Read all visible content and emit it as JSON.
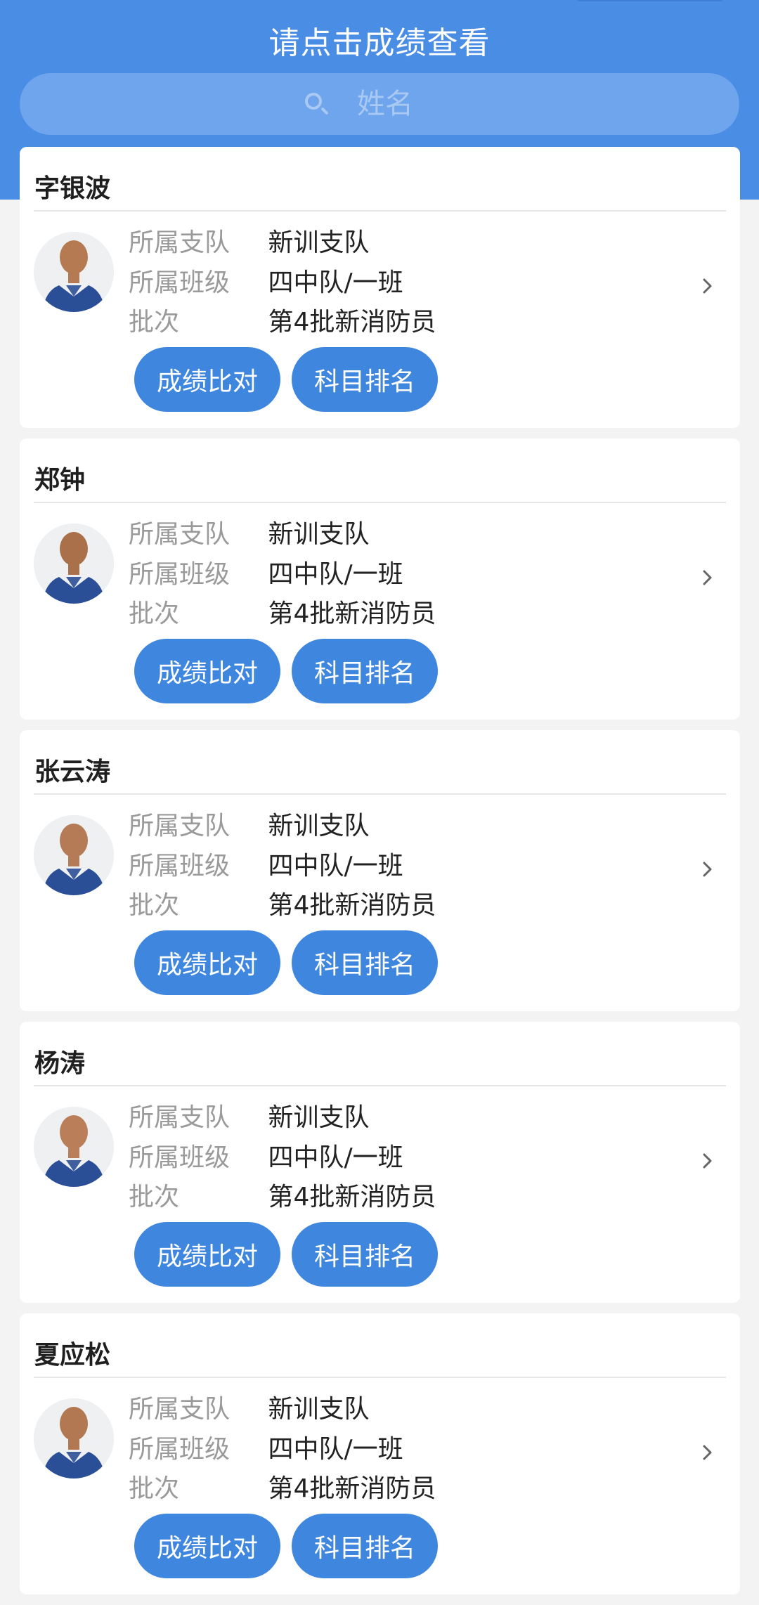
{
  "header": {
    "title": "请点击成绩查看",
    "search_placeholder": "姓名"
  },
  "labels": {
    "branch": "所属支队",
    "class": "所属班级",
    "batch": "批次",
    "compare_button": "成绩比对",
    "rank_button": "科目排名"
  },
  "people": [
    {
      "name": "字银波",
      "branch": "新训支队",
      "class": "四中队/一班",
      "batch": "第4批新消防员"
    },
    {
      "name": "郑钟",
      "branch": "新训支队",
      "class": "四中队/一班",
      "batch": "第4批新消防员"
    },
    {
      "name": "张云涛",
      "branch": "新训支队",
      "class": "四中队/一班",
      "batch": "第4批新消防员"
    },
    {
      "name": "杨涛",
      "branch": "新训支队",
      "class": "四中队/一班",
      "batch": "第4批新消防员"
    },
    {
      "name": "夏应松",
      "branch": "新训支队",
      "class": "四中队/一班",
      "batch": "第4批新消防员"
    }
  ],
  "icons": {
    "search": "search-icon",
    "chevron": "chevron-right-icon",
    "avatar": "avatar"
  },
  "colors": {
    "primary": "#4a8de4",
    "button": "#3f86df",
    "search_bg": "#6ea5ec",
    "page_bg": "#f3f3f3"
  }
}
